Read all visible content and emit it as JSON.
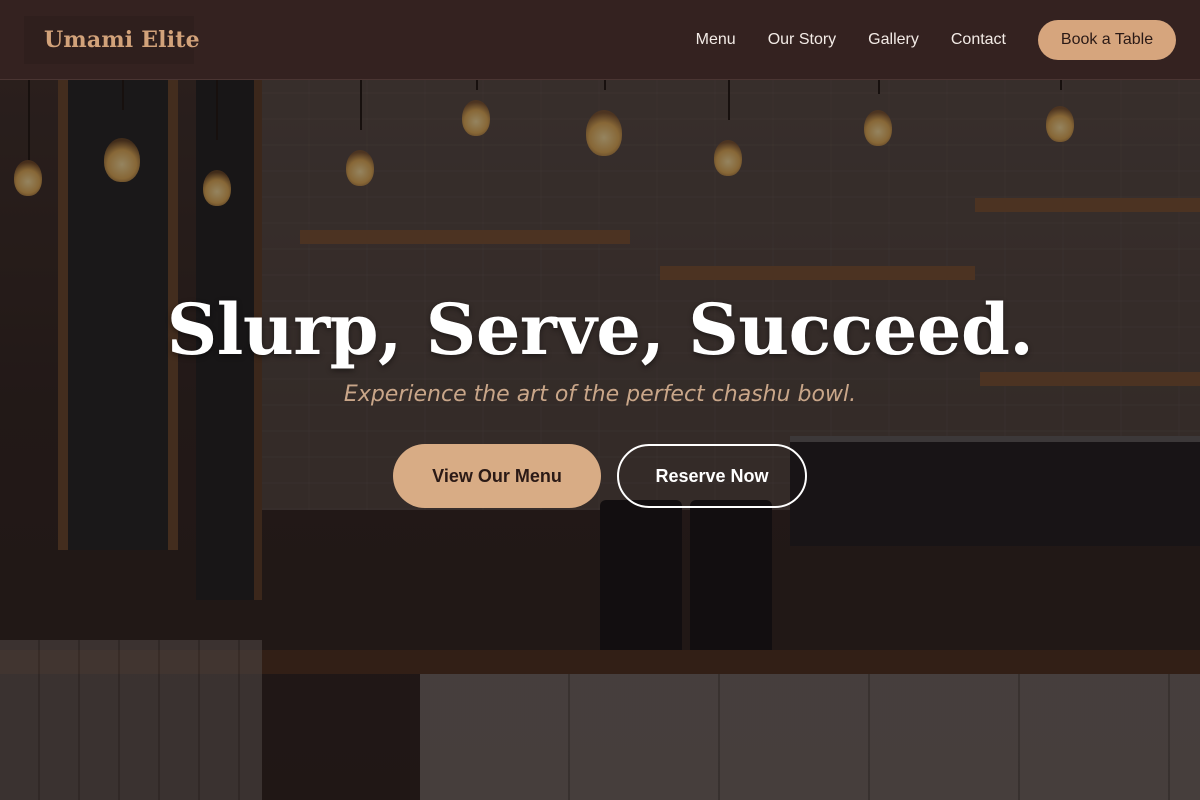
{
  "header": {
    "logo": "Umami Elite",
    "nav": [
      {
        "label": "Menu"
      },
      {
        "label": "Our Story"
      },
      {
        "label": "Gallery"
      },
      {
        "label": "Contact"
      }
    ],
    "cta_label": "Book a Table"
  },
  "hero": {
    "title": "Slurp, Serve, Succeed.",
    "subtitle": "Experience the art of the perfect chashu bowl.",
    "primary_button": "View Our Menu",
    "secondary_button": "Reserve Now"
  },
  "colors": {
    "header_bg": "#342220",
    "accent": "#d6a57d",
    "logo": "#d2a27a",
    "subtitle": "#c9a689"
  }
}
